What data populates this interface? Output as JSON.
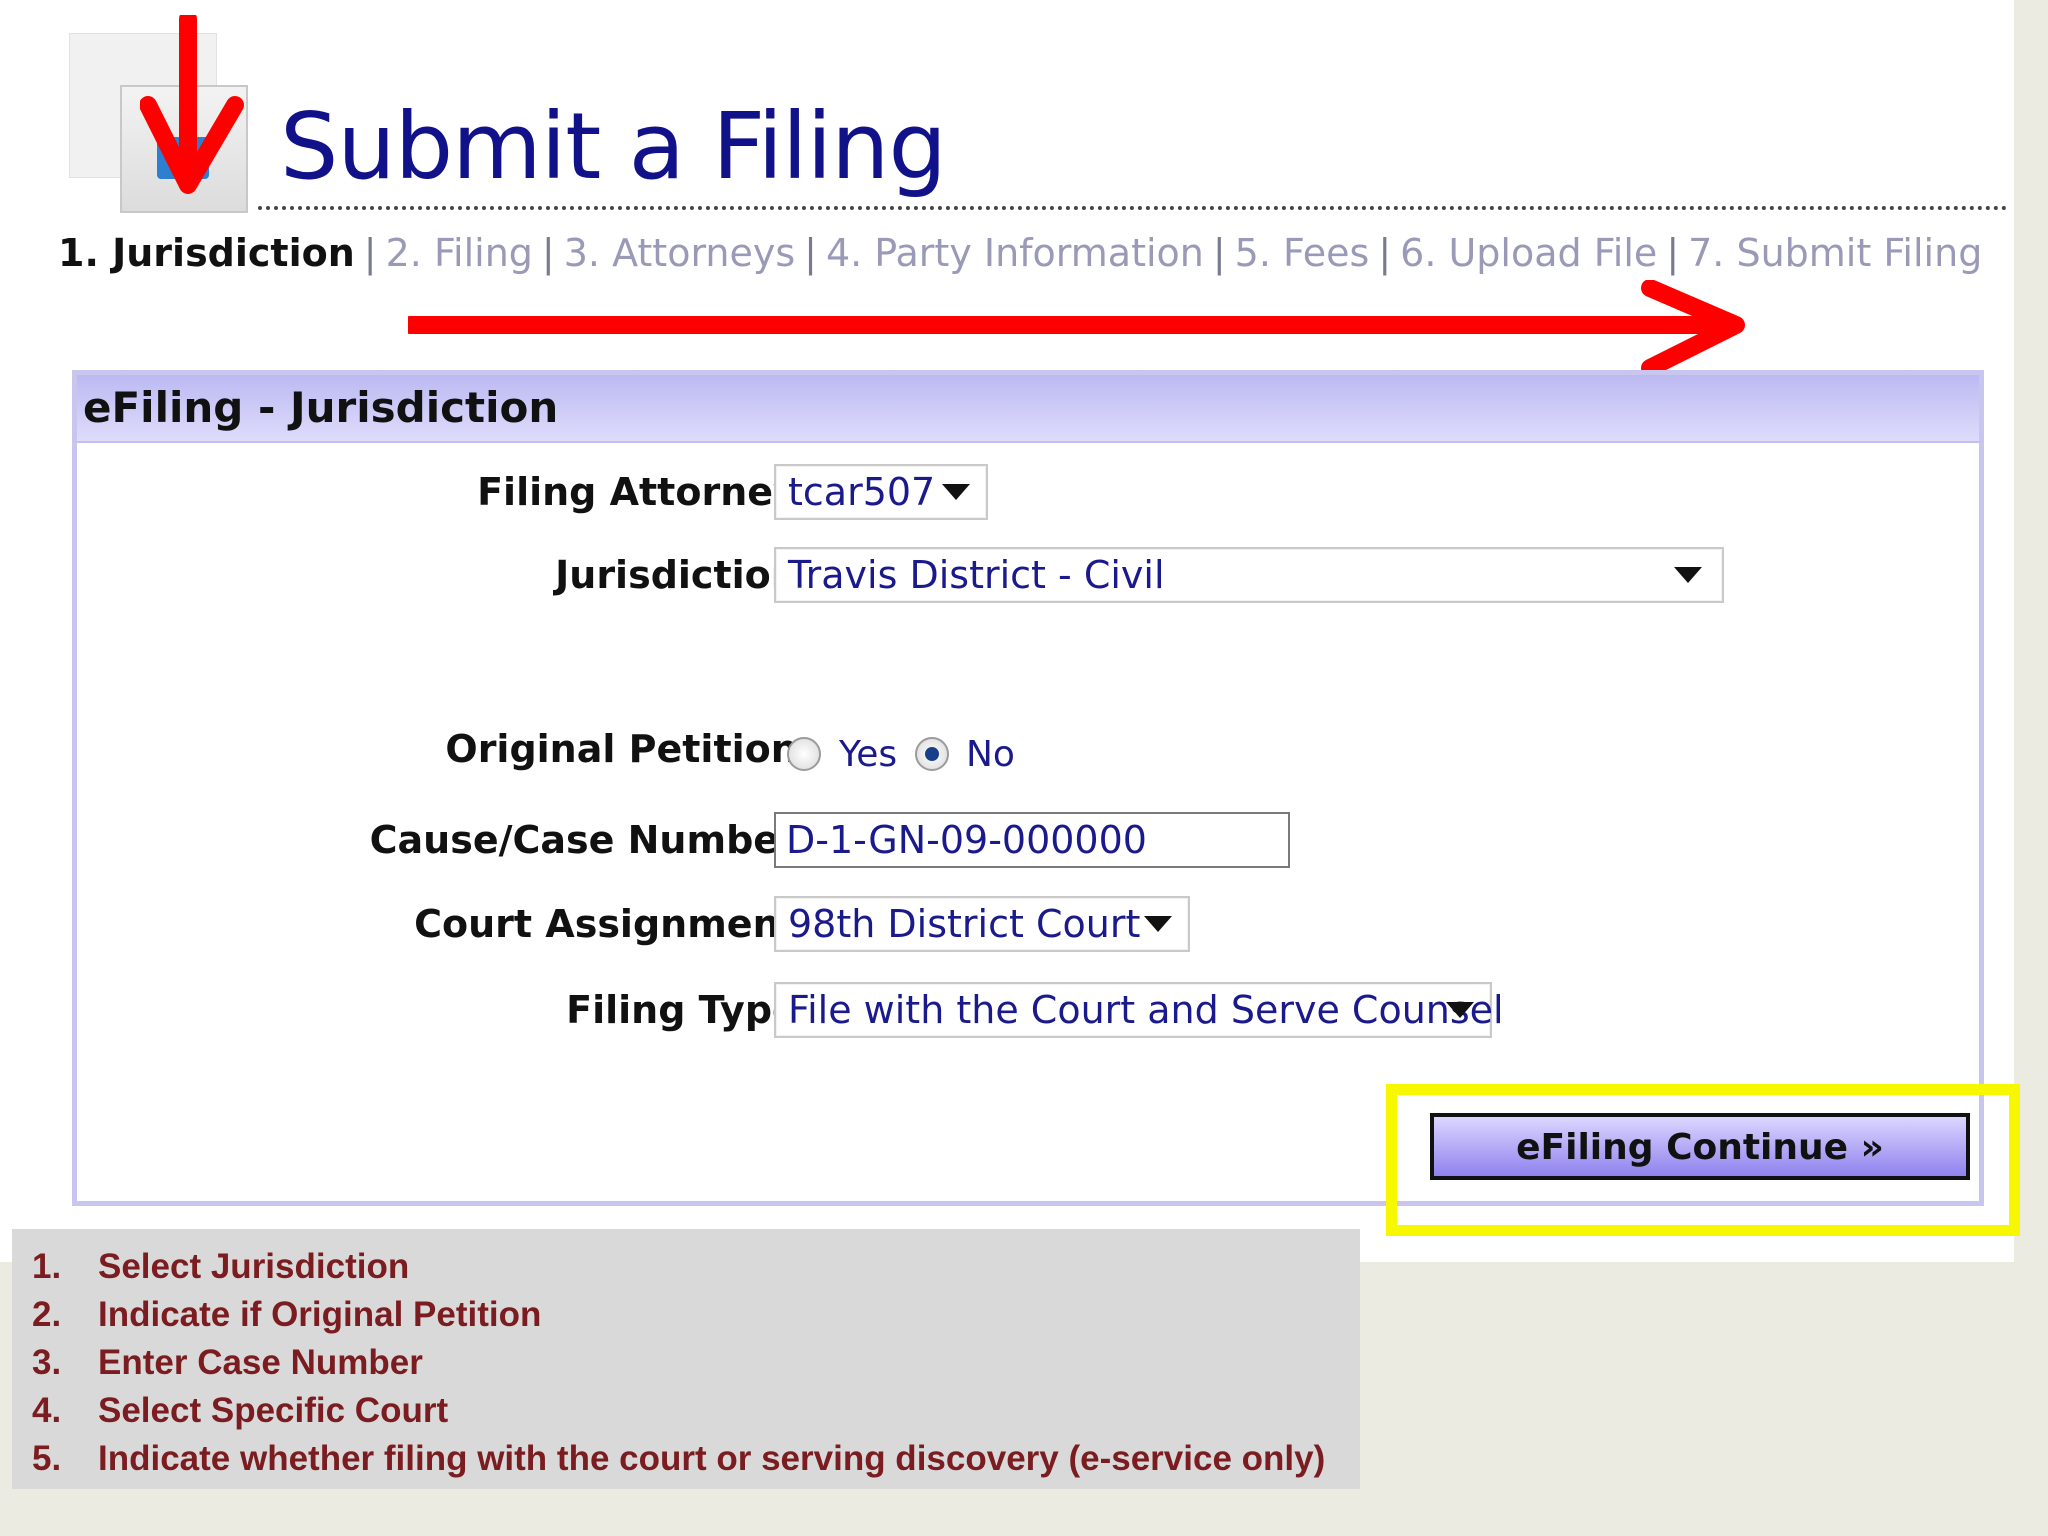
{
  "page": {
    "title": "Submit a Filing"
  },
  "steps": [
    {
      "label": "1. Jurisdiction",
      "active": true
    },
    {
      "label": "2. Filing",
      "active": false
    },
    {
      "label": "3. Attorneys",
      "active": false
    },
    {
      "label": "4. Party Information",
      "active": false
    },
    {
      "label": "5. Fees",
      "active": false
    },
    {
      "label": "6. Upload File",
      "active": false
    },
    {
      "label": "7. Submit Filing",
      "active": false
    }
  ],
  "step_separator": "|",
  "panel": {
    "title": "eFiling - Jurisdiction",
    "fields": {
      "filing_attorney": {
        "label": "Filing Attorney:",
        "value": "tcar507"
      },
      "jurisdiction": {
        "label": "Jurisdiction:",
        "value": "Travis District - Civil"
      },
      "original_petition": {
        "label": "Original Petition:",
        "yes": "Yes",
        "no": "No",
        "selected": "No"
      },
      "case_number": {
        "label": "Cause/Case Number:",
        "value": "D-1-GN-09-000000"
      },
      "court_assignment": {
        "label": "Court Assignment:",
        "value": "98th District Court"
      },
      "filing_type": {
        "label": "Filing Type:",
        "value": "File with the Court and Serve Counsel"
      }
    },
    "continue_label": "eFiling Continue »"
  },
  "instructions": [
    {
      "num": "1.",
      "text": "Select Jurisdiction"
    },
    {
      "num": "2.",
      "text": "Indicate if Original Petition"
    },
    {
      "num": "3.",
      "text": "Enter Case Number"
    },
    {
      "num": "4.",
      "text": "Select Specific Court"
    },
    {
      "num": "5.",
      "text": "Indicate whether filing with the court or  serving discovery (e-service only)"
    }
  ],
  "colors": {
    "annotation_arrow": "#ff0000",
    "highlight": "#f7f700",
    "link": "#1a1a8c",
    "instruction_text": "#7a1c20"
  },
  "icons": [
    "filing-page-icon",
    "arrow-down-annotation",
    "arrow-right-annotation",
    "dropdown-caret-icon"
  ]
}
